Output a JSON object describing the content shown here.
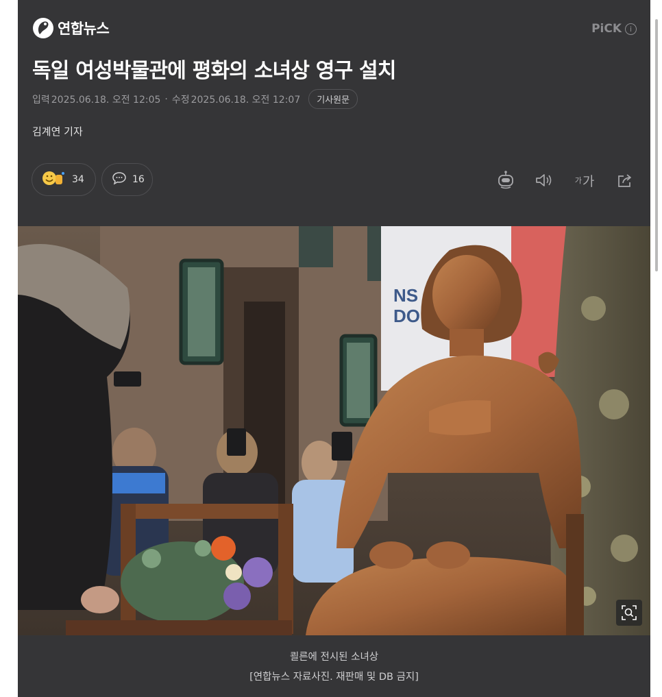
{
  "brand": {
    "name": "연합뉴스",
    "logo_icon": "yonhap-logo-icon"
  },
  "pick": {
    "label": "PiCK",
    "info_icon": "info-circle-icon"
  },
  "article": {
    "headline": "독일 여성박물관에 평화의 소녀상 영구 설치",
    "published_label": "입력",
    "published": "2025.06.18. 오전 12:05",
    "modified_label": "수정",
    "modified": "2025.06.18. 오전 12:07",
    "original_button": "기사원문",
    "reporter": "김계연 기자"
  },
  "reactions": {
    "count": "34",
    "icon": "reaction-emoji-icon"
  },
  "comments": {
    "count": "16",
    "icon": "comment-bubble-icon"
  },
  "tools": {
    "summary_icon": "robot-icon",
    "audio_icon": "speaker-icon",
    "font_size_label": "가",
    "font_size_small_label": "가",
    "share_icon": "share-icon"
  },
  "photo": {
    "zoom_icon": "zoom-search-icon"
  },
  "caption": {
    "line1": "쾰른에 전시된 소녀상",
    "line2": "[연합뉴스 자료사진. 재판매 및 DB 금지]"
  },
  "colors": {
    "background": "#353537",
    "text": "#f2f2f2",
    "muted": "#9c9c9f",
    "accent_bronze": "#a8683a"
  }
}
